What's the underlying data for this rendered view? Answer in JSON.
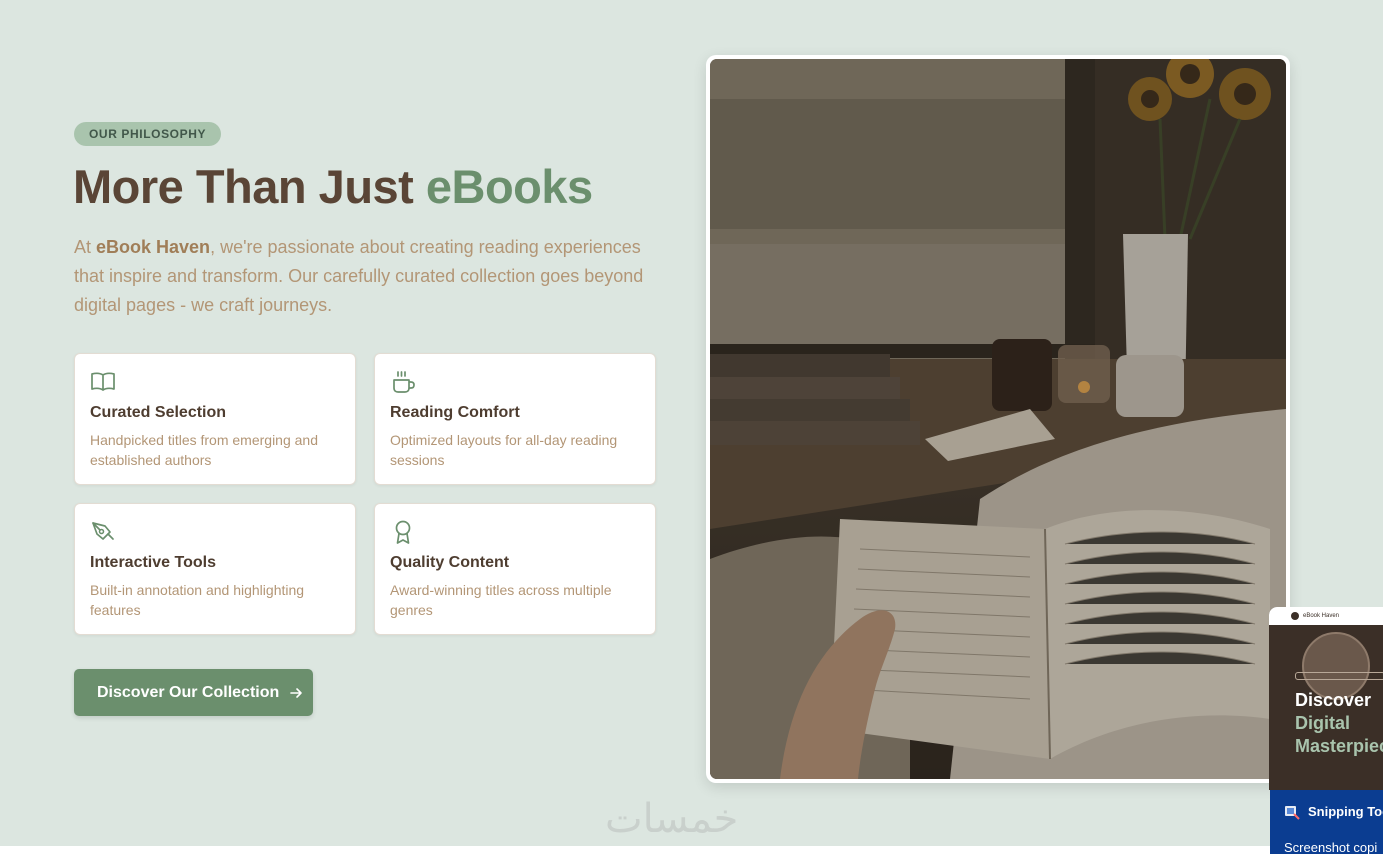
{
  "badge": "OUR PHILOSOPHY",
  "title": {
    "prefix": "More Than Just ",
    "accent": "eBooks"
  },
  "intro": {
    "before": "At ",
    "brand": "eBook Haven",
    "after": ", we're passionate about creating reading experiences that inspire and transform. Our carefully curated collection goes beyond digital pages - we craft journeys."
  },
  "features": [
    {
      "icon": "open-book-icon",
      "title": "Curated Selection",
      "desc": "Handpicked titles from emerging and established authors"
    },
    {
      "icon": "coffee-cup-icon",
      "title": "Reading Comfort",
      "desc": "Optimized layouts for all-day reading sessions"
    },
    {
      "icon": "pen-tool-icon",
      "title": "Interactive Tools",
      "desc": "Built-in annotation and highlighting features"
    },
    {
      "icon": "award-icon",
      "title": "Quality Content",
      "desc": "Award-winning titles across multiple genres"
    }
  ],
  "cta": {
    "label": "Discover Our Collection"
  },
  "watermark": "خمسات",
  "thumbnail": {
    "brand": "eBook Haven",
    "line1": "Discover",
    "line2": "Digital",
    "line3": "Masterpiec"
  },
  "toast": {
    "title": "Snipping Tool",
    "message": "Screenshot copi"
  },
  "colors": {
    "background": "#dce6e0",
    "accent_green": "#6b8f6d",
    "heading_brown": "#5a4536",
    "body_tan": "#b39676"
  }
}
